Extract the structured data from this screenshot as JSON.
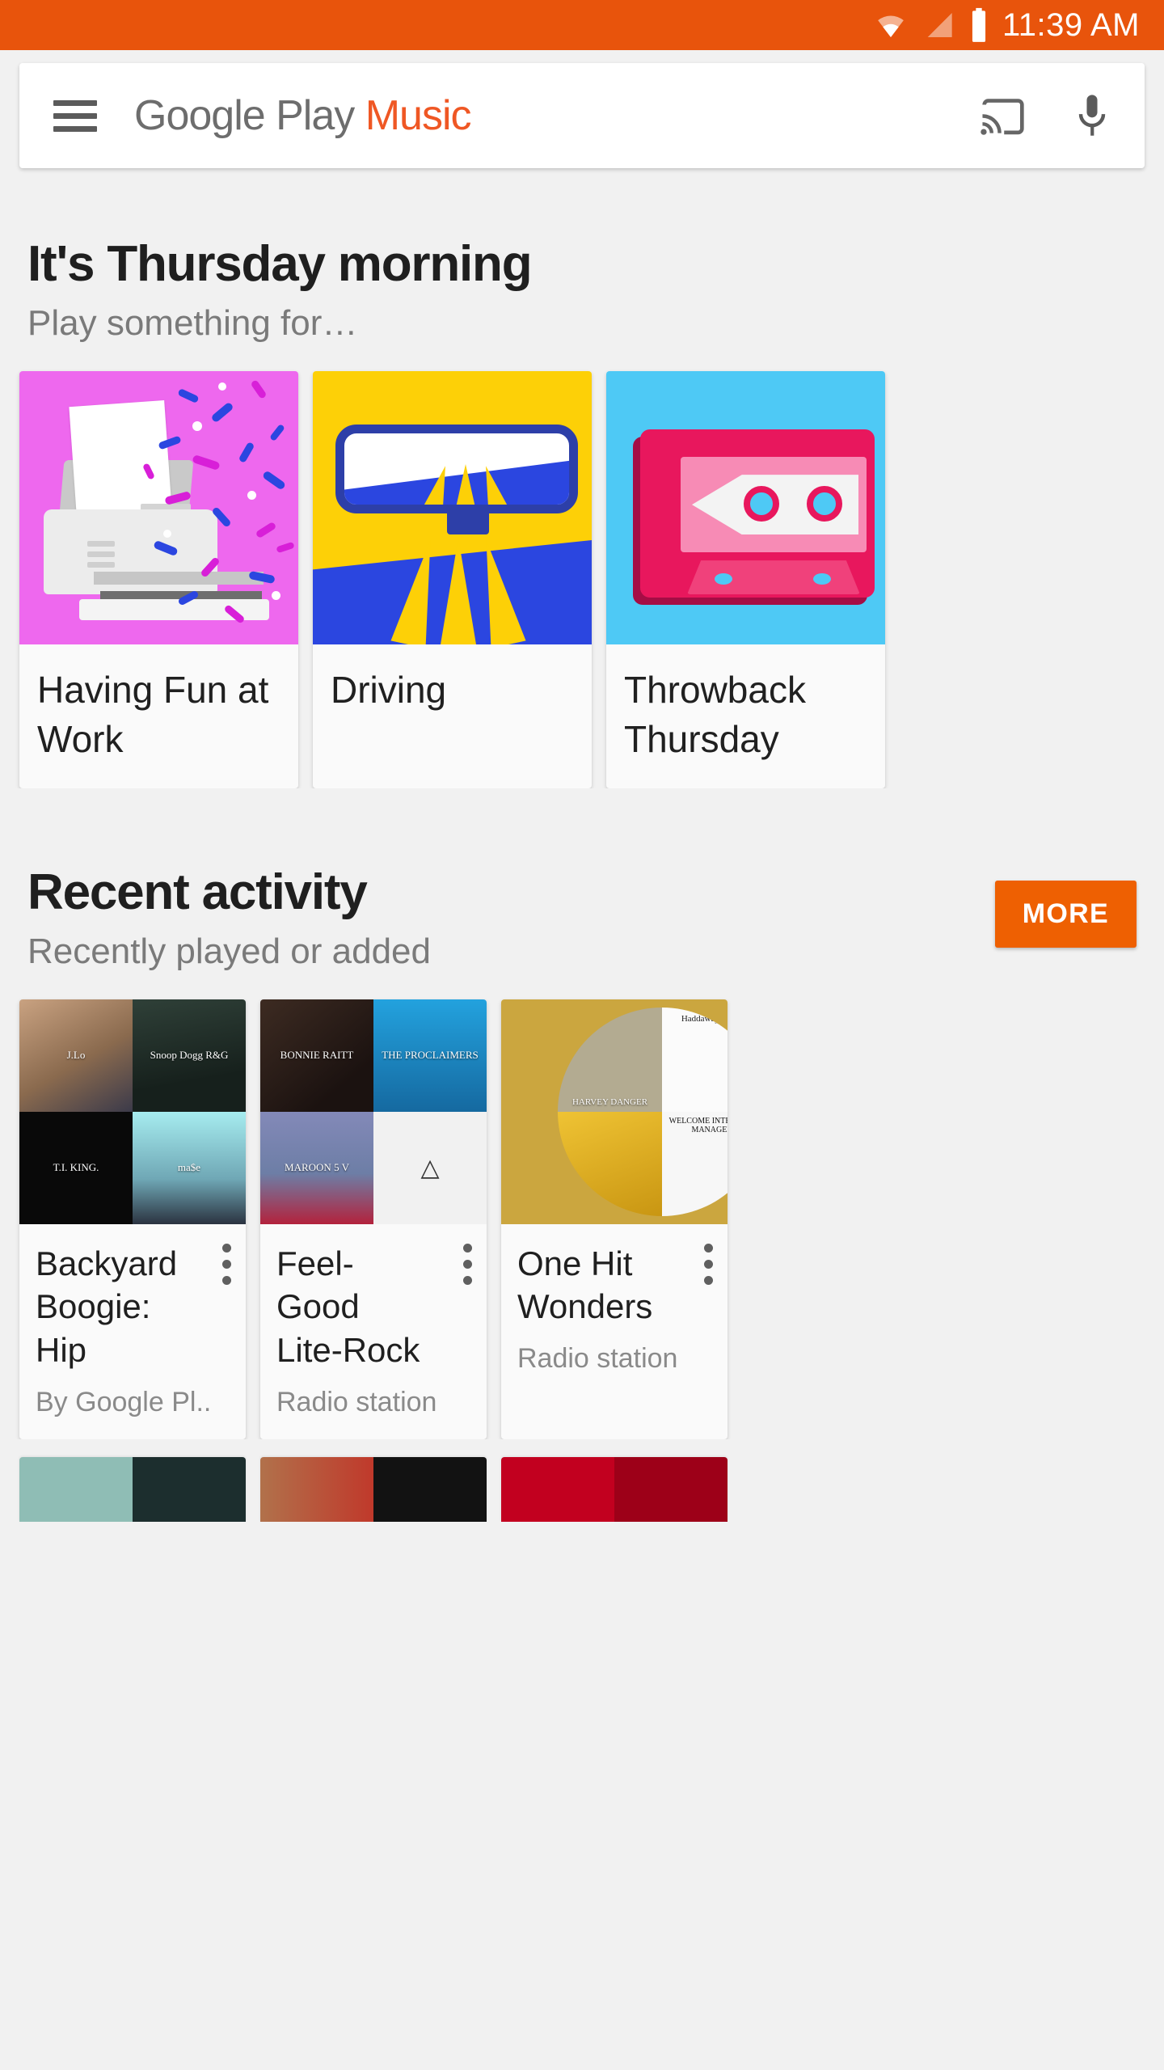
{
  "status_bar": {
    "time": "11:39 AM",
    "icons": [
      "wifi-icon",
      "cell-signal-icon",
      "battery-icon"
    ],
    "background_color": "#e8540c"
  },
  "app_bar": {
    "menu_icon": "hamburger-menu-icon",
    "brand_part1": "Google Play ",
    "brand_part2": "Music",
    "brand_accent_color": "#ef5724",
    "cast_icon": "cast-icon",
    "mic_icon": "microphone-icon"
  },
  "mood_section": {
    "title": "It's Thursday morning",
    "subtitle": "Play something for…",
    "cards": [
      {
        "label": "Having Fun at Work",
        "art": "printer-confetti-illustration",
        "bg": "#ee68ee"
      },
      {
        "label": "Driving",
        "art": "rearview-mirror-road-illustration",
        "bg": "#fdd007"
      },
      {
        "label": "Throwback Thursday",
        "art": "cassette-tape-illustration",
        "bg": "#4ec9f5"
      }
    ]
  },
  "recent_section": {
    "title": "Recent activity",
    "subtitle": "Recently played or added",
    "more_label": "MORE",
    "more_color": "#ee6002",
    "cards": [
      {
        "title": "Backyard Boogie: Hip",
        "subtitle": "By Google Pl..",
        "menu_icon": "kebab-menu-icon",
        "art_type": "four-tile-grid",
        "tiles": [
          {
            "name": "jennifer-lopez-jlo-album-art",
            "text": "J.Lo",
            "bg": "#8a6a4e"
          },
          {
            "name": "snoop-dogg-rg-album-art",
            "text": "Snoop Dogg R&G",
            "bg": "#1d2a24"
          },
          {
            "name": "ti-king-album-art",
            "text": "T.I. KING.",
            "bg": "#0a0a0a"
          },
          {
            "name": "mase-harlem-world-album-art",
            "text": "ma$e",
            "bg": "#9fe8ee"
          }
        ]
      },
      {
        "title": "Feel-Good Lite-Rock",
        "subtitle": "Radio station",
        "menu_icon": "kebab-menu-icon",
        "art_type": "four-tile-grid",
        "tiles": [
          {
            "name": "bonnie-raitt-luck-of-the-draw-album-art",
            "text": "BONNIE RAITT",
            "bg": "#2a1c18"
          },
          {
            "name": "the-proclaimers-sunshine-on-leith-album-art",
            "text": "THE PROCLAIMERS",
            "bg": "#1f82c6"
          },
          {
            "name": "maroon-5-v-album-art",
            "text": "MAROON 5 V",
            "bg": "#6a6f9c"
          },
          {
            "name": "alt-j-an-awesome-wave-album-art",
            "text": "△",
            "bg": "#f2f2f2"
          }
        ]
      },
      {
        "title": "One Hit Wonders",
        "subtitle": "Radio station",
        "menu_icon": "kebab-menu-icon",
        "art_type": "circular-collage",
        "bg": "#cbA63f",
        "tiles": [
          {
            "name": "harvey-danger-album-art",
            "text": "HARVEY DANGER",
            "bg": "#b8b096"
          },
          {
            "name": "haddaway-what-is-love-album-art",
            "text": "Haddaway what is",
            "bg": "#ffffff"
          },
          {
            "name": "yellow-house-album-art",
            "text": "",
            "bg": "#e8b425"
          },
          {
            "name": "fountains-of-wayne-welcome-interstate-managers-album-art",
            "text": "WELCOME INTERSTATE MANAGERS",
            "bg": "#ffffff"
          }
        ]
      }
    ]
  },
  "peek_row": {
    "cards": [
      {
        "name": "fabolous-album-art",
        "bg": "#8fbdb5",
        "bg2": "#1c2e2e"
      },
      {
        "name": "young-album-art",
        "bg": "#8c5a3c",
        "bg2": "#141414"
      },
      {
        "name": "red-album-art",
        "bg": "#c2001f",
        "bg2": "#8d0016"
      }
    ]
  }
}
